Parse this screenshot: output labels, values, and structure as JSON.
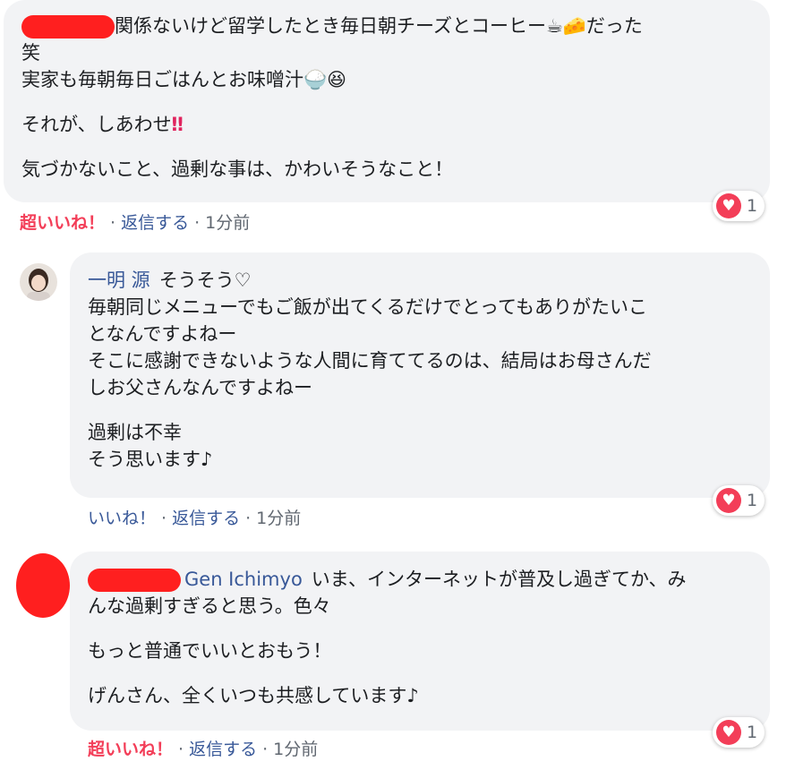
{
  "comment1": {
    "lines": [
      "関係ないけど留学したとき毎日朝チーズとコーヒー☕🧀だった",
      "笑",
      "実家も毎朝毎日ごはんとお味噌汁🍚😆",
      "それが、しあわせ",
      "気づかないこと、過剰な事は、かわいそうなこと！"
    ],
    "exclaim": "‼",
    "like": "超いいね！",
    "reply": "返信する",
    "time": "1分前",
    "reaction_count": "1"
  },
  "comment2": {
    "author": "一明 源",
    "first": "そうそう♡",
    "lines": [
      "毎朝同じメニューでもご飯が出てくるだけでとってもありがたいこ",
      "となんですよねー",
      "そこに感謝できないような人間に育ててるのは、結局はお母さんだ",
      "しお父さんなんですよねー",
      "過剰は不幸",
      "そう思います♪"
    ],
    "like": "いいね！",
    "reply": "返信する",
    "time": "1分前",
    "reaction_count": "1"
  },
  "comment3": {
    "mention": "Gen Ichimyo",
    "lines": [
      "いま、インターネットが普及し過ぎてか、み",
      "んな過剰すぎると思う。色々",
      "もっと普通でいいとおもう！",
      "げんさん、全くいつも共感しています♪"
    ],
    "like": "超いいね！",
    "reply": "返信する",
    "time": "1分前",
    "reaction_count": "1"
  }
}
